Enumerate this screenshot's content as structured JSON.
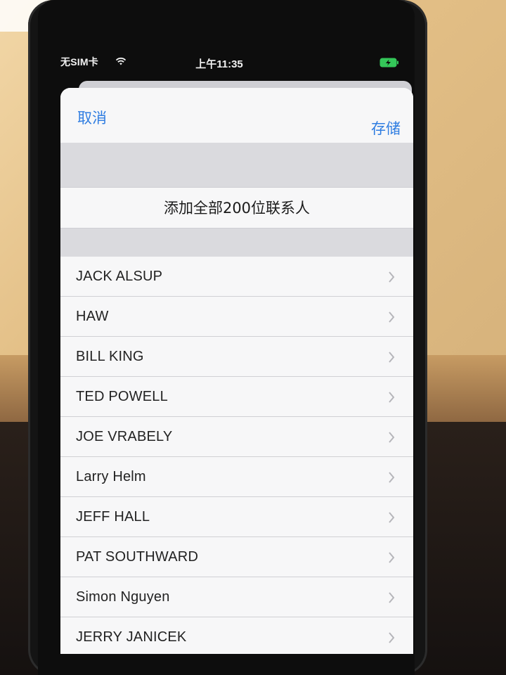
{
  "status_bar": {
    "carrier": "无SIM卡",
    "time": "上午11:35"
  },
  "nav": {
    "cancel_label": "取消",
    "save_label": "存储"
  },
  "add_all_label": "添加全部200位联系人",
  "contacts": [
    "JACK ALSUP",
    "HAW",
    "BILL KING",
    "TED POWELL",
    "JOE VRABELY",
    "Larry Helm",
    "JEFF HALL",
    "PAT SOUTHWARD",
    "Simon Nguyen",
    "JERRY JANICEK"
  ],
  "colors": {
    "accent": "#2f7de1",
    "battery": "#34c759"
  },
  "icons": {
    "wifi": "wifi-icon",
    "battery": "battery-charging-icon",
    "row_chevron": "chevron-right-icon"
  }
}
